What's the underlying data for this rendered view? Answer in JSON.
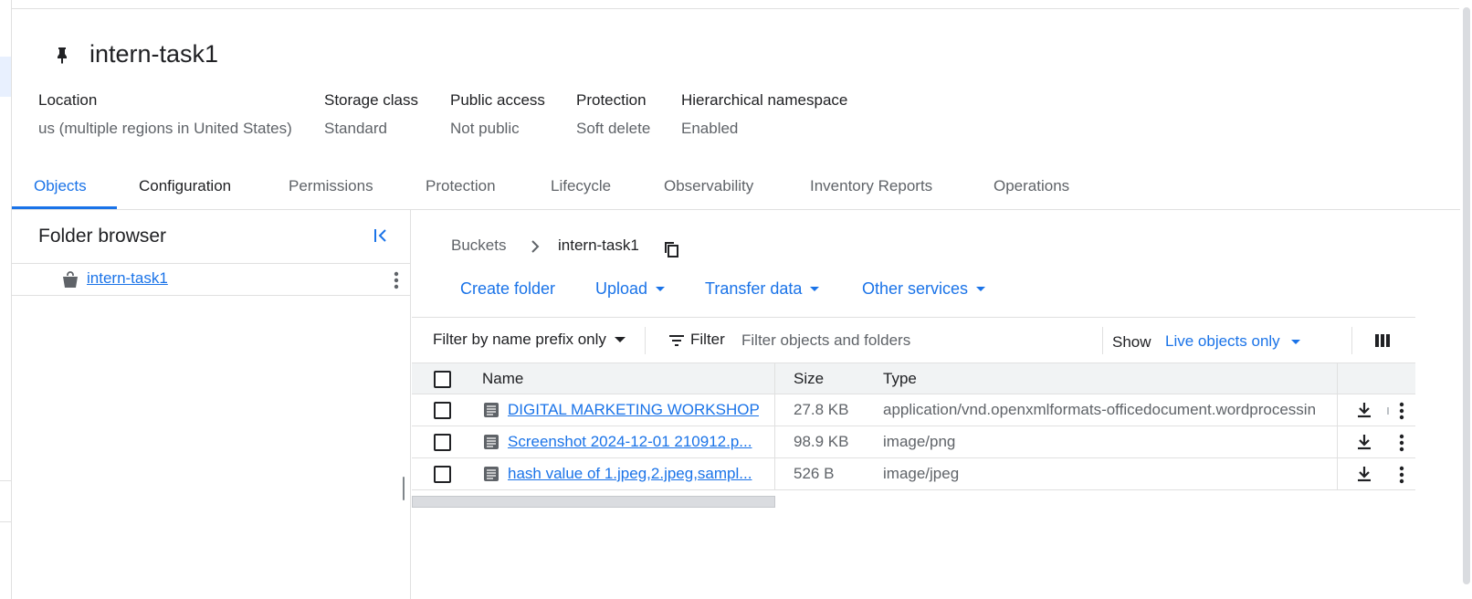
{
  "bucket": {
    "name": "intern-task1"
  },
  "meta": [
    {
      "label": "Location",
      "value": "us (multiple regions in United States)"
    },
    {
      "label": "Storage class",
      "value": "Standard"
    },
    {
      "label": "Public access",
      "value": "Not public"
    },
    {
      "label": "Protection",
      "value": "Soft delete"
    },
    {
      "label": "Hierarchical namespace",
      "value": "Enabled"
    }
  ],
  "tabs": [
    {
      "label": "Objects",
      "active": true
    },
    {
      "label": "Configuration"
    },
    {
      "label": "Permissions"
    },
    {
      "label": "Protection"
    },
    {
      "label": "Lifecycle"
    },
    {
      "label": "Observability"
    },
    {
      "label": "Inventory Reports"
    },
    {
      "label": "Operations"
    }
  ],
  "folder_browser": {
    "title": "Folder browser",
    "root": "intern-task1"
  },
  "breadcrumb": {
    "root": "Buckets",
    "current": "intern-task1"
  },
  "actions": {
    "create_folder": "Create folder",
    "upload": "Upload",
    "transfer_data": "Transfer data",
    "other_services": "Other services"
  },
  "filter": {
    "mode": "Filter by name prefix only",
    "label": "Filter",
    "placeholder": "Filter objects and folders",
    "show_label": "Show",
    "show_value": "Live objects only"
  },
  "table": {
    "headers": {
      "name": "Name",
      "size": "Size",
      "type": "Type"
    },
    "rows": [
      {
        "name": "DIGITAL MARKETING WORKSHOP...",
        "size": "27.8 KB",
        "type": "application/vnd.openxmlformats-officedocument.wordprocessin"
      },
      {
        "name": "Screenshot 2024-12-01 210912.p...",
        "size": "98.9 KB",
        "type": "image/png"
      },
      {
        "name": "hash value of 1.jpeg,2.jpeg,sampl...",
        "size": "526 B",
        "type": "image/jpeg"
      }
    ]
  },
  "colors": {
    "accent": "#1a73e8",
    "text": "#202124",
    "muted": "#5f6368",
    "border": "#e0e0e0"
  }
}
